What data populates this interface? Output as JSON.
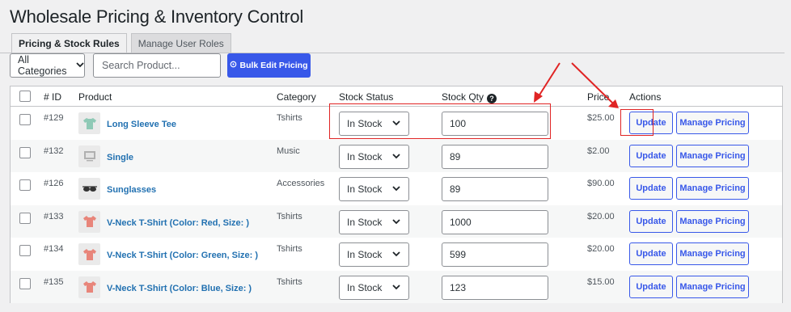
{
  "page_title": "Wholesale Pricing & Inventory Control",
  "tabs": [
    {
      "label": "Pricing & Stock Rules",
      "active": true
    },
    {
      "label": "Manage User Roles",
      "active": false
    }
  ],
  "toolbar": {
    "category_select": "All Categories",
    "search_placeholder": "Search Product...",
    "bulk_button": "Bulk Edit Pricing"
  },
  "columns": {
    "id": "# ID",
    "product": "Product",
    "category": "Category",
    "stock_status": "Stock Status",
    "stock_qty": "Stock Qty",
    "price": "Price",
    "actions": "Actions"
  },
  "rows": [
    {
      "id": "#129",
      "product": "Long Sleeve Tee",
      "icon": "shirt-icon",
      "icon_color": "#8fc9b6",
      "category": "Tshirts",
      "stock_status": "In Stock",
      "qty": "100",
      "price": "$25.00"
    },
    {
      "id": "#132",
      "product": "Single",
      "icon": "album-icon",
      "icon_color": "#b0b0b0",
      "category": "Music",
      "stock_status": "In Stock",
      "qty": "89",
      "price": "$2.00"
    },
    {
      "id": "#126",
      "product": "Sunglasses",
      "icon": "sunglasses-icon",
      "icon_color": "#333333",
      "category": "Accessories",
      "stock_status": "In Stock",
      "qty": "89",
      "price": "$90.00"
    },
    {
      "id": "#133",
      "product": "V-Neck T-Shirt (Color: Red, Size: )",
      "icon": "tshirt-icon",
      "icon_color": "#e8857a",
      "category": "Tshirts",
      "stock_status": "In Stock",
      "qty": "1000",
      "price": "$20.00"
    },
    {
      "id": "#134",
      "product": "V-Neck T-Shirt (Color: Green, Size: )",
      "icon": "tshirt-icon",
      "icon_color": "#e8857a",
      "category": "Tshirts",
      "stock_status": "In Stock",
      "qty": "599",
      "price": "$20.00"
    },
    {
      "id": "#135",
      "product": "V-Neck T-Shirt (Color: Blue, Size: )",
      "icon": "tshirt-icon",
      "icon_color": "#e8857a",
      "category": "Tshirts",
      "stock_status": "In Stock",
      "qty": "123",
      "price": "$15.00"
    }
  ],
  "actions": {
    "update": "Update",
    "manage_pricing": "Manage Pricing"
  },
  "colors": {
    "accent": "#3858e9",
    "link": "#2271b1",
    "annotation": "#e02424"
  }
}
